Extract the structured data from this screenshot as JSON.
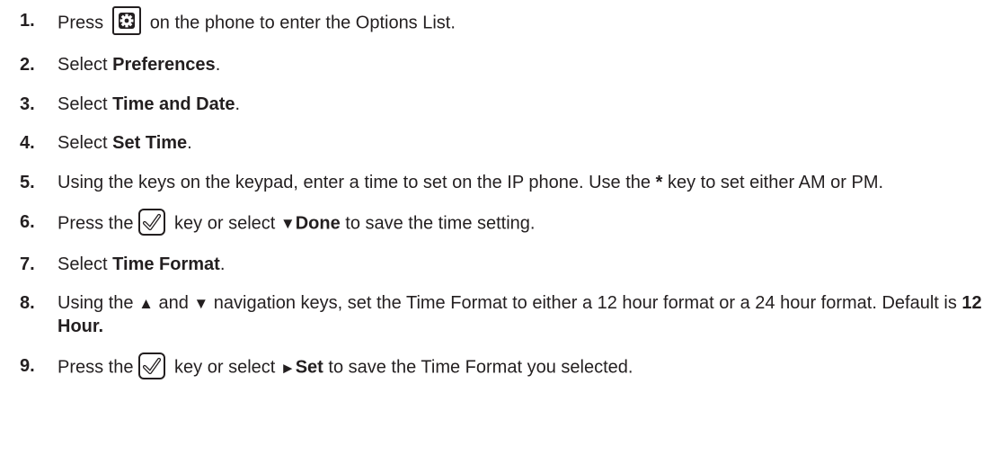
{
  "steps": [
    {
      "num": "1.",
      "t1": "Press",
      "t2": "on the phone to enter the Options List."
    },
    {
      "num": "2.",
      "t1": "Select ",
      "b1": "Preferences",
      "t2": "."
    },
    {
      "num": "3.",
      "t1": "Select ",
      "b1": "Time and Date",
      "t2": "."
    },
    {
      "num": "4.",
      "t1": "Select ",
      "b1": "Set Time",
      "t2": "."
    },
    {
      "num": "5.",
      "t1": "Using the keys on the keypad, enter a time to set on the IP phone. Use the ",
      "b1": "*",
      "t2": " key to set either AM or PM."
    },
    {
      "num": "6.",
      "t1": "Press the",
      "t2": "key or select ",
      "glyph": "▼",
      "b1": "Done",
      "t3": " to save the time setting."
    },
    {
      "num": "7.",
      "t1": "Select ",
      "b1": "Time Format",
      "t2": "."
    },
    {
      "num": "8.",
      "t1": "Using the ",
      "up": "▲",
      "t2": " and ",
      "down": "▼",
      "t3": " navigation keys, set the Time Format to either a 12 hour format or a 24 hour format. Default is ",
      "b1": "12 Hour."
    },
    {
      "num": "9.",
      "t1": "Press the",
      "t2": "key or select ",
      "glyph": "►",
      "b1": "Set",
      "t3": " to save the Time Format you selected."
    }
  ],
  "icons": {
    "options_key": "gear-icon",
    "ok_key": "checkmark-icon"
  }
}
